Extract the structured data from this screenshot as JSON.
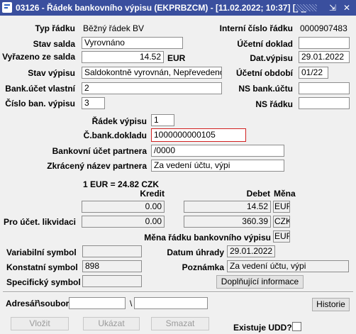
{
  "window": {
    "title": "03126 - Řádek bankovního výpisu (EKPRBZCM) - [11.02.2022; 10:37] [] []",
    "restore": "⇲",
    "close": "✕"
  },
  "header": {
    "typ_radku_label": "Typ řádku",
    "typ_radku_value": "Běžný řádek BV",
    "interni_cislo_label": "Interní číslo řádku",
    "interni_cislo_value": "0000907483",
    "stav_salda_label": "Stav salda",
    "stav_salda_value": "Vyrovnáno",
    "ucetni_doklad_label": "Účetní doklad",
    "ucetni_doklad_value": "",
    "vyrazeno_label": "Vyřazeno ze salda",
    "vyrazeno_value": "14.52",
    "vyrazeno_currency": "EUR",
    "dat_vypisu_label": "Dat.výpisu",
    "dat_vypisu_value": "29.01.2022",
    "stav_vypisu_label": "Stav výpisu",
    "stav_vypisu_value": "Saldokontně vyrovnán, Nepřevedeno",
    "ucetni_obdobi_label": "Účetní období",
    "ucetni_obdobi_value": "01/22",
    "bank_ucet_label": "Bank.účet vlastní",
    "bank_ucet_value": "2",
    "ns_bank_uctu_label": "NS bank.účtu",
    "ns_bank_uctu_value": "",
    "cislo_vypisu_label": "Číslo ban. výpisu",
    "cislo_vypisu_value": "3",
    "ns_radku_label": "NS řádku",
    "ns_radku_value": ""
  },
  "detail": {
    "radek_vypisu_label": "Řádek výpisu",
    "radek_vypisu_value": "1",
    "c_bank_dokladu_label": "Č.bank.dokladu",
    "c_bank_dokladu_value": "1000000000105",
    "bankovni_ucet_partnera_label": "Bankovní účet partnera",
    "bankovni_ucet_partnera_value": "/0000",
    "zkraceny_nazev_label": "Zkrácený název partnera",
    "zkraceny_nazev_value": "Za vedení účtu, výpi"
  },
  "amounts": {
    "rate": "1 EUR = 24.82 CZK",
    "kredit_label": "Kredit",
    "debet_label": "Debet",
    "mena_label": "Měna",
    "kredit_1": "0.00",
    "debet_1": "14.52",
    "mena_1": "EUR",
    "pro_ucet_label": "Pro účet. likvidaci",
    "kredit_2": "0.00",
    "debet_2": "360.39",
    "mena_2": "CZK",
    "mena_radku_label": "Měna řádku bankovního výpisu",
    "mena_radku_value": "EUR"
  },
  "symbols": {
    "variabilni_label": "Variabilní symbol",
    "variabilni_value": "",
    "datum_uhrady_label": "Datum úhrady",
    "datum_uhrady_value": "29.01.2022",
    "konstantni_label": "Konstatní symbol",
    "konstantni_value": "898",
    "poznamka_label": "Poznámka",
    "poznamka_value": "Za vedení účtu, výpi",
    "specificky_label": "Specifický symbol",
    "specificky_value": "",
    "doplnujici_button": "Doplňující informace"
  },
  "footer": {
    "adresar_label": "Adresář\\soubor",
    "adresar_value": "",
    "backslash": "\\",
    "soubor_value": "",
    "historie_button": "Historie",
    "vlozit_button": "Vložit",
    "ukazat_button": "Ukázat",
    "smazat_button": "Smazat",
    "existuje_udd_label": "Existuje UDD?"
  }
}
